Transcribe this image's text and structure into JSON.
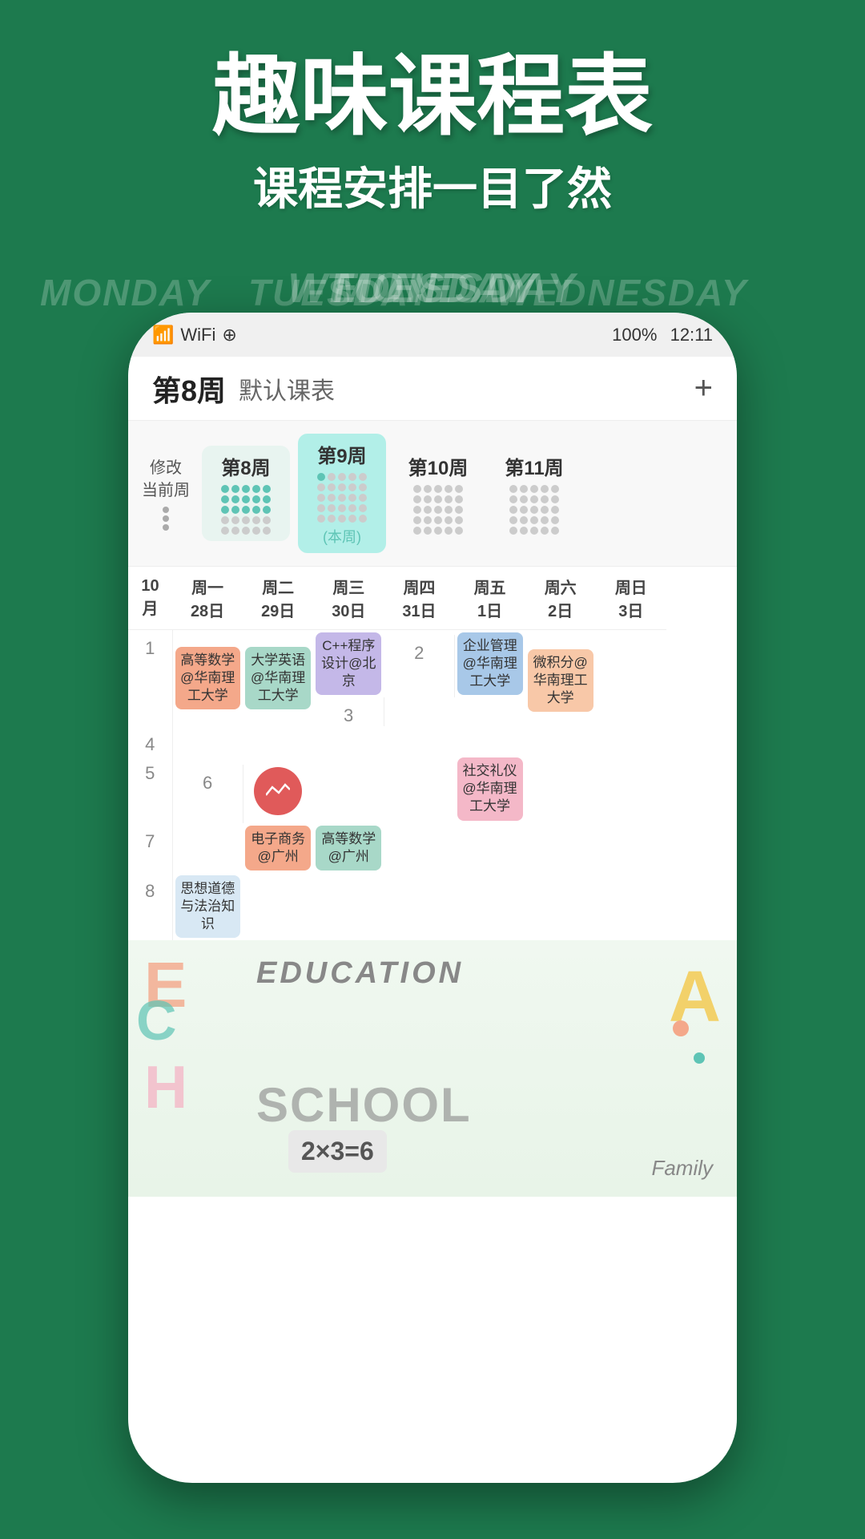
{
  "background": {
    "color": "#1d7a4e"
  },
  "chalk_labels": [
    "MONDAY",
    "TUESDAY",
    "WEDNESDAY"
  ],
  "header": {
    "main_title": "趣味课程表",
    "sub_title": "课程安排一目了然"
  },
  "status_bar": {
    "signal": "📶",
    "wifi": "WiFi",
    "battery": "100%",
    "time": "12:11"
  },
  "app_header": {
    "week": "第8周",
    "schedule_name": "默认课表",
    "add_icon": "+"
  },
  "week_selector": {
    "modify_label": "修改\n当前周",
    "weeks": [
      {
        "label": "第8周",
        "is_current": false,
        "dots_active": 15,
        "dots_total": 25
      },
      {
        "label": "第9周",
        "is_current": true,
        "sub_label": "(本周)",
        "dots_active": 3,
        "dots_total": 25
      },
      {
        "label": "第10周",
        "is_current": false,
        "dots_active": 0,
        "dots_total": 25
      },
      {
        "label": "第11周",
        "is_current": false,
        "dots_active": 0,
        "dots_total": 25
      }
    ]
  },
  "timetable": {
    "header": {
      "month": "10\n月",
      "days": [
        {
          "name": "周一",
          "date": "28日"
        },
        {
          "name": "周二",
          "date": "29日"
        },
        {
          "name": "周三",
          "date": "30日"
        },
        {
          "name": "周四",
          "date": "31日"
        },
        {
          "name": "周五",
          "date": "1日"
        },
        {
          "name": "周六",
          "date": "2日"
        },
        {
          "name": "周日",
          "date": "3日"
        }
      ]
    },
    "rows": [
      {
        "num": "1",
        "cells": [
          {
            "text": "高等数学@华南理工大学",
            "color": "salmon",
            "span": 3
          },
          {
            "text": "大学英语@华南理工大学",
            "color": "mint",
            "span": 3
          },
          {
            "text": "C++程序设计@北京",
            "color": "lavender",
            "span": 2
          },
          {
            "text": "",
            "color": "",
            "span": 1
          },
          {
            "text": "企业管理@华南理工大学",
            "color": "sky",
            "span": 2
          },
          {
            "text": "",
            "color": "",
            "span": 1
          },
          {
            "text": "",
            "color": "",
            "span": 1
          }
        ]
      },
      {
        "num": "2",
        "cells": []
      },
      {
        "num": "3",
        "cells": [
          {
            "text": "微积分@华南理工大学",
            "color": "peach",
            "span": 2
          }
        ]
      },
      {
        "num": "4",
        "cells": []
      },
      {
        "num": "5",
        "cells": [
          {
            "text": "社交礼仪@华南理工大学",
            "color": "pink",
            "span": 2
          }
        ]
      },
      {
        "num": "6",
        "cells": []
      },
      {
        "num": "7",
        "cells": [
          {
            "text": "电子商务@广州",
            "color": "salmon",
            "span": 1
          },
          {
            "text": "高等数学@广州",
            "color": "mint",
            "span": 1
          }
        ]
      },
      {
        "num": "8",
        "cells": [
          {
            "text": "思想道德与法治知识",
            "color": "lavender",
            "span": 1
          }
        ]
      }
    ]
  },
  "sticker": {
    "letters": [
      "E",
      "C",
      "H",
      "A"
    ],
    "text": "EDUCATION\nSCHOOL"
  }
}
